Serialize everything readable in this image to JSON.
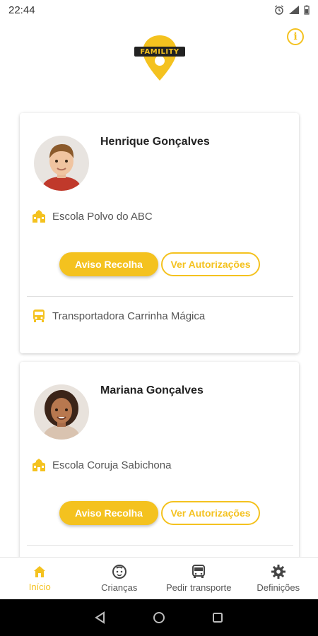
{
  "status_bar": {
    "time": "22:44"
  },
  "header": {
    "logo_text": "FAMILITY",
    "info_label": "i"
  },
  "children": [
    {
      "name": "Henrique Gonçalves",
      "school": "Escola Polvo do ABC",
      "transport": "Transportadora Carrinha Mágica",
      "primary_button": "Aviso Recolha",
      "secondary_button": "Ver Autorizações"
    },
    {
      "name": "Mariana Gonçalves",
      "school": "Escola Coruja Sabichona",
      "primary_button": "Aviso Recolha",
      "secondary_button": "Ver Autorizações"
    }
  ],
  "bottom_nav": [
    {
      "label": "Início",
      "icon": "home-icon",
      "active": true
    },
    {
      "label": "Crianças",
      "icon": "child-face-icon",
      "active": false
    },
    {
      "label": "Pedir transporte",
      "icon": "bus-icon",
      "active": false
    },
    {
      "label": "Definições",
      "icon": "gear-icon",
      "active": false
    }
  ],
  "colors": {
    "accent": "#f4c21f",
    "text": "#222222",
    "muted": "#555555"
  }
}
